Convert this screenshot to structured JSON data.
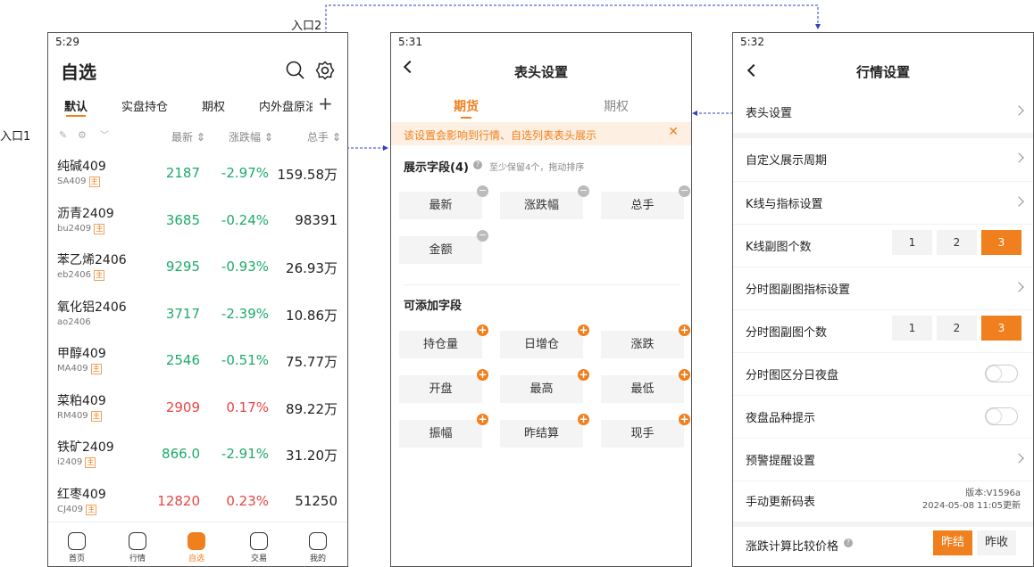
{
  "annotations": {
    "entry1": "入口1",
    "entry2": "入口2"
  },
  "screen1": {
    "time": "5:29",
    "title": "自选",
    "tabs": [
      "默认",
      "实盘持仓",
      "期权",
      "内外盘原油"
    ],
    "columns": {
      "latest": "最新",
      "change": "涨跌幅",
      "volume": "总手"
    },
    "rows": [
      {
        "name": "纯碱409",
        "code": "SA409",
        "tag": "主",
        "price": "2187",
        "pct": "-2.97%",
        "vol": "159.58万",
        "dir": "dn"
      },
      {
        "name": "沥青2409",
        "code": "bu2409",
        "tag": "主",
        "price": "3685",
        "pct": "-0.24%",
        "vol": "98391",
        "dir": "dn"
      },
      {
        "name": "苯乙烯2406",
        "code": "eb2406",
        "tag": "主",
        "price": "9295",
        "pct": "-0.93%",
        "vol": "26.93万",
        "dir": "dn"
      },
      {
        "name": "氧化铝2406",
        "code": "ao2406",
        "tag": "",
        "price": "3717",
        "pct": "-2.39%",
        "vol": "10.86万",
        "dir": "dn"
      },
      {
        "name": "甲醇409",
        "code": "MA409",
        "tag": "主",
        "price": "2546",
        "pct": "-0.51%",
        "vol": "75.77万",
        "dir": "dn"
      },
      {
        "name": "菜粕409",
        "code": "RM409",
        "tag": "主",
        "price": "2909",
        "pct": "0.17%",
        "vol": "89.22万",
        "dir": "up"
      },
      {
        "name": "铁矿2409",
        "code": "i2409",
        "tag": "主",
        "price": "866.0",
        "pct": "-2.91%",
        "vol": "31.20万",
        "dir": "dn"
      },
      {
        "name": "红枣409",
        "code": "CJ409",
        "tag": "主",
        "price": "12820",
        "pct": "0.23%",
        "vol": "51250",
        "dir": "up"
      }
    ],
    "nav": [
      "首页",
      "行情",
      "自选",
      "交易",
      "我的"
    ]
  },
  "screen2": {
    "time": "5:31",
    "title": "表头设置",
    "tabs": [
      "期货",
      "期权"
    ],
    "notice": "该设置会影响到行情、自选列表表头展示",
    "shown_title": "展示字段(4)",
    "shown_hint": "至少保留4个，拖动排序",
    "shown": [
      "最新",
      "涨跌幅",
      "总手",
      "金额"
    ],
    "addable_title": "可添加字段",
    "addable": [
      "持仓量",
      "日增仓",
      "涨跌",
      "开盘",
      "最高",
      "最低",
      "振幅",
      "昨结算",
      "现手"
    ]
  },
  "screen3": {
    "time": "5:32",
    "title": "行情设置",
    "items": {
      "header": "表头设置",
      "period": "自定义展示周期",
      "kline": "K线与指标设置",
      "kline_count": "K线副图个数",
      "ts_indicator": "分时图副图指标设置",
      "ts_count": "分时图副图个数",
      "ts_split": "分时图区分日夜盘",
      "night": "夜盘品种提示",
      "alert": "预警提醒设置",
      "manual": "手动更新码表",
      "compare": "涨跌计算比较价格"
    },
    "version": "版本:V1596a",
    "updated": "2024-05-08 11:05更新",
    "counts": [
      "1",
      "2",
      "3"
    ],
    "compare_opts": [
      "昨结",
      "昨收"
    ]
  },
  "colors": {
    "accent": "#f07f1d",
    "up": "#e84545",
    "down": "#1daa6a",
    "link": "#2a40c8"
  }
}
